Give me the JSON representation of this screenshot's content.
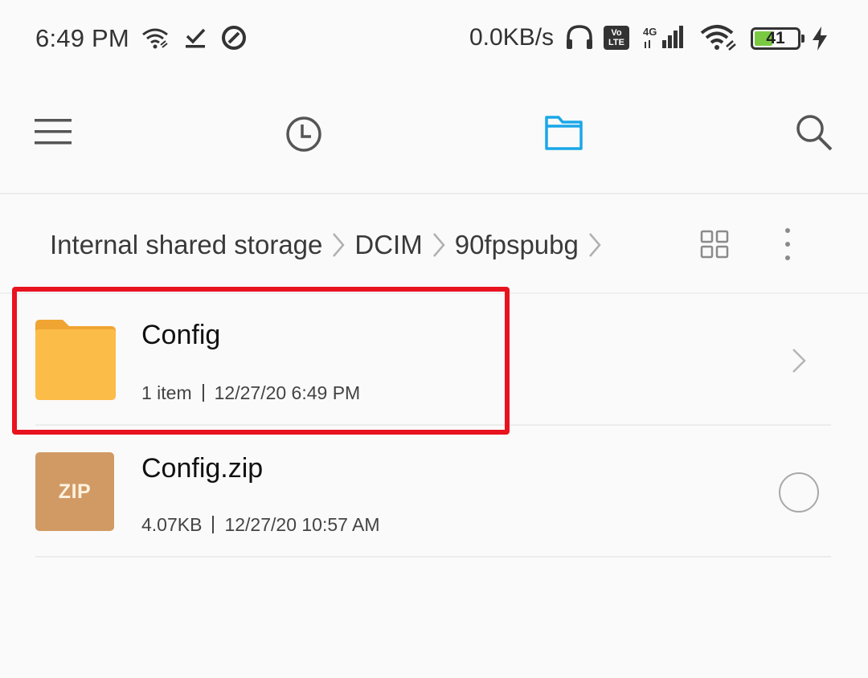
{
  "status_bar": {
    "time": "6:49 PM",
    "net_speed": "0.0KB/s",
    "network_badge": "Vo LTE",
    "network_type": "4G",
    "battery_percent": "41",
    "icons": [
      "wifi-link-icon",
      "download-done-icon",
      "data-saver-icon",
      "headset-icon",
      "volte-icon",
      "signal-4g-icon",
      "wifi-icon",
      "battery-icon",
      "charging-icon"
    ]
  },
  "toolbar": {
    "icons": [
      "menu-icon",
      "recent-clock-icon",
      "folder-icon",
      "search-icon"
    ],
    "active_color": "#1aa7e8"
  },
  "breadcrumb": {
    "items": [
      "Internal shared storage",
      "DCIM",
      "90fpspubg"
    ]
  },
  "files": [
    {
      "name": "Config",
      "meta_left": "1 item",
      "meta_right": "12/27/20 6:49 PM",
      "type": "folder",
      "highlighted": true
    },
    {
      "name": "Config.zip",
      "meta_left": "4.07KB",
      "meta_right": "12/27/20 10:57 AM",
      "type": "zip",
      "badge": "ZIP"
    }
  ],
  "colors": {
    "folder": "#fbbd48",
    "zip": "#d19a64",
    "highlight": "#e8131f"
  }
}
